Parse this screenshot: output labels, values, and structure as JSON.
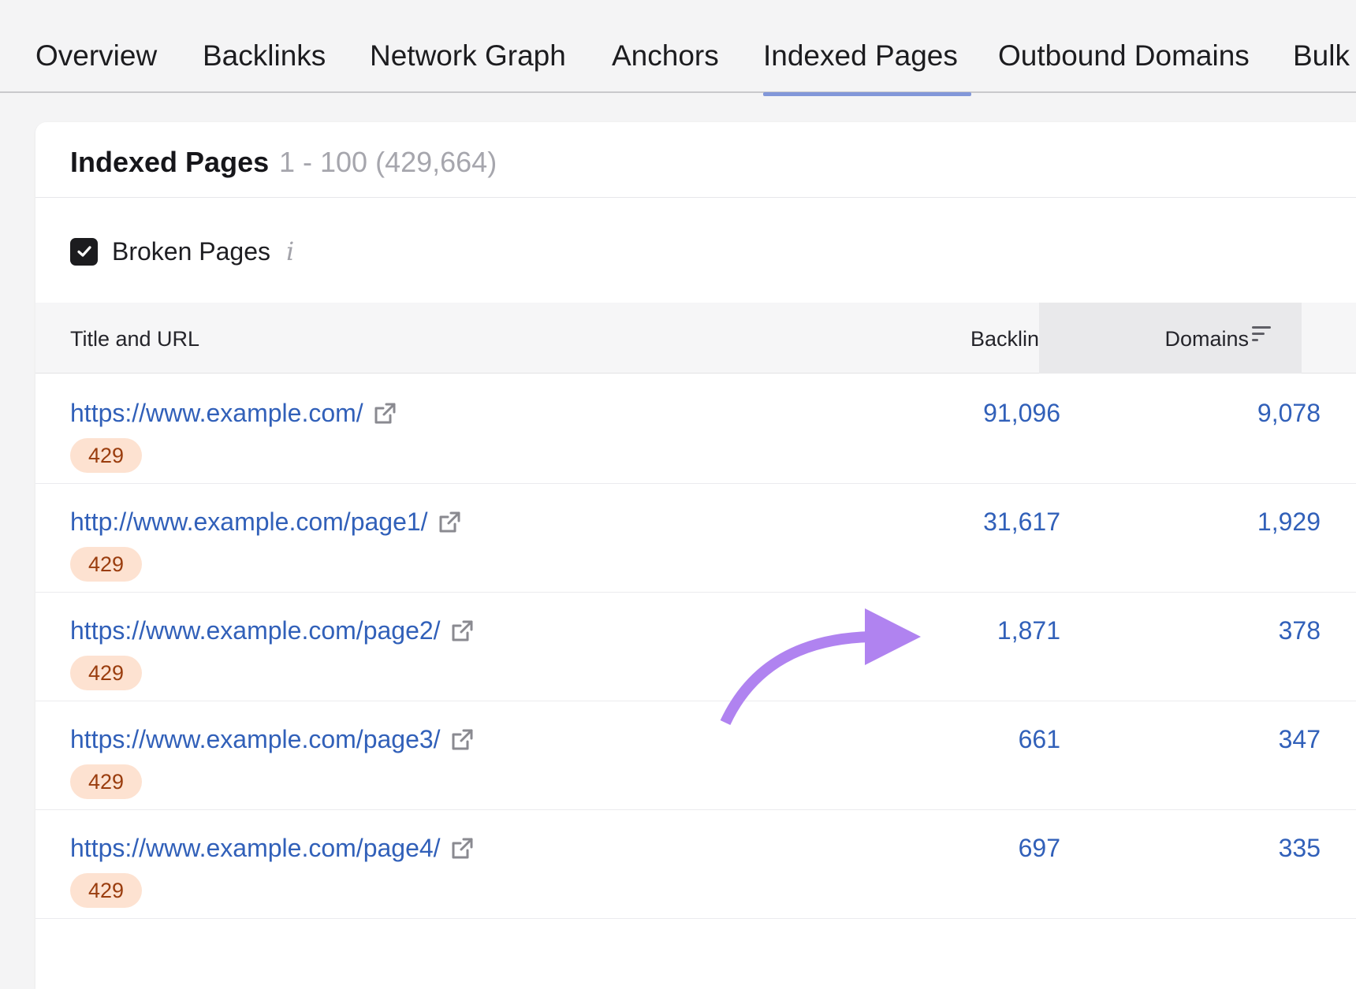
{
  "tabs": [
    "Overview",
    "Backlinks",
    "Network Graph",
    "Anchors",
    "Indexed Pages",
    "Outbound Domains",
    "Bulk"
  ],
  "active_tab": "Indexed Pages",
  "card": {
    "title": "Indexed Pages",
    "range": "1 - 100 (429,664)"
  },
  "filter": {
    "label": "Broken Pages",
    "checked": true,
    "info_icon": "i"
  },
  "table": {
    "columns": {
      "title_url": "Title and URL",
      "backlinks": "Backlinks",
      "domains": "Domains"
    },
    "sorted_by": "Domains",
    "rows": [
      {
        "url": "https://www.example.com/",
        "status": "429",
        "backlinks": "91,096",
        "domains": "9,078"
      },
      {
        "url": "http://www.example.com/page1/",
        "status": "429",
        "backlinks": "31,617",
        "domains": "1,929"
      },
      {
        "url": "https://www.example.com/page2/",
        "status": "429",
        "backlinks": "1,871",
        "domains": "378"
      },
      {
        "url": "https://www.example.com/page3/",
        "status": "429",
        "backlinks": "661",
        "domains": "347"
      },
      {
        "url": "https://www.example.com/page4/",
        "status": "429",
        "backlinks": "697",
        "domains": "335"
      }
    ]
  },
  "colors": {
    "link": "#3160b9",
    "tab_underline": "#8297d9",
    "badge_bg": "#fde2d1",
    "badge_text": "#9a3d0e",
    "annotation_arrow": "#b083f0"
  },
  "icons": {
    "external_link": "external-link-icon",
    "checkbox": "checkmark-icon",
    "sort": "sort-descending-icon",
    "annotation": "curved-arrow-icon"
  }
}
